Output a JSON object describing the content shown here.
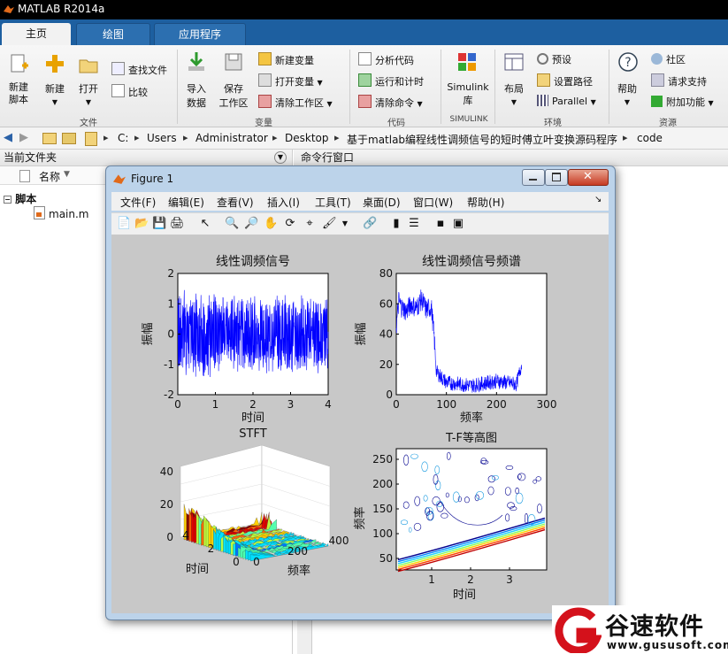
{
  "app": {
    "title": "MATLAB R2014a"
  },
  "tabs": [
    "主页",
    "绘图",
    "应用程序"
  ],
  "ribbon": {
    "big_buttons": [
      {
        "label": "新建\n脚本",
        "icon": "new-script-icon"
      },
      {
        "label": "新建",
        "icon": "new-icon"
      },
      {
        "label": "打开",
        "icon": "open-folder-icon"
      },
      {
        "label": "导入\n数据",
        "icon": "import-data-icon"
      },
      {
        "label": "保存\n工作区",
        "icon": "save-workspace-icon"
      },
      {
        "label": "Simulink\n库",
        "icon": "simulink-library-icon"
      },
      {
        "label": "布局",
        "icon": "layout-icon"
      },
      {
        "label": "帮助",
        "icon": "help-icon"
      }
    ],
    "small_buttons": {
      "find_files": "查找文件",
      "compare": "比较",
      "new_variable": "新建变量",
      "open_variable": "打开变量",
      "clear_workspace": "清除工作区",
      "analyze_code": "分析代码",
      "run_and_time": "运行和计时",
      "clear_commands": "清除命令",
      "preferences": "预设",
      "set_path": "设置路径",
      "parallel": "Parallel",
      "community": "社区",
      "request_support": "请求支持",
      "add_ons": "附加功能"
    },
    "groups": [
      "文件",
      "变量",
      "代码",
      "SIMULINK",
      "环境",
      "资源"
    ]
  },
  "address": {
    "path": [
      "C:",
      "Users",
      "Administrator",
      "Desktop",
      "基于matlab编程线性调频信号的短时傅立叶变换源码程序",
      "code"
    ]
  },
  "left_panel": {
    "title": "当前文件夹",
    "column_name": "名称",
    "sort_indicator": "▼",
    "tree": {
      "folder": "脚本",
      "file": "main.m"
    }
  },
  "command_window": {
    "title": "命令行窗口"
  },
  "figure": {
    "title": "Figure 1",
    "menu": [
      "文件(F)",
      "编辑(E)",
      "查看(V)",
      "插入(I)",
      "工具(T)",
      "桌面(D)",
      "窗口(W)",
      "帮助(H)"
    ]
  },
  "chart_data": [
    {
      "type": "line",
      "title": "线性调频信号",
      "xlabel": "时间",
      "ylabel": "振幅",
      "xlim": [
        0,
        4
      ],
      "ylim": [
        -2,
        2
      ],
      "xticks": [
        "0",
        "1",
        "2",
        "3",
        "4"
      ],
      "yticks": [
        "-2",
        "-1",
        "0",
        "1",
        "2"
      ],
      "series": [
        {
          "color": "#0000ff",
          "description_values": {
            "x_range": [
              0,
              4
            ],
            "amplitude_range": [
              -1.5,
              1.6
            ]
          }
        }
      ]
    },
    {
      "type": "line",
      "title": "线性调频信号频谱",
      "xlabel": "频率",
      "ylabel": "振幅",
      "xlim": [
        0,
        300
      ],
      "ylim": [
        0,
        80
      ],
      "xticks": [
        "0",
        "100",
        "200",
        "300"
      ],
      "yticks": [
        "0",
        "20",
        "40",
        "60",
        "80"
      ],
      "series": [
        {
          "color": "#0000ff",
          "x": [
            0,
            5,
            10,
            20,
            30,
            40,
            50,
            60,
            70,
            75,
            80,
            100,
            150,
            200,
            240,
            250
          ],
          "y": [
            45,
            62,
            58,
            55,
            60,
            57,
            63,
            56,
            58,
            40,
            15,
            8,
            6,
            9,
            7,
            20
          ]
        }
      ]
    },
    {
      "type": "surface",
      "title": "STFT",
      "xlabel": "频率",
      "ylabel": "时间",
      "zlim": [
        0,
        40
      ],
      "zticks": [
        "0",
        "20",
        "40"
      ],
      "xticks": [
        "0",
        "200",
        "400"
      ],
      "yticks": [
        "0",
        "2",
        "4"
      ]
    },
    {
      "type": "contour",
      "title": "T-F等高图",
      "xlabel": "时间",
      "ylabel": "频率",
      "xticks": [
        "1",
        "2",
        "3"
      ],
      "yticks": [
        "50",
        "100",
        "150",
        "200",
        "250"
      ]
    }
  ],
  "watermark": {
    "brand": "谷速软件",
    "url": "www.gususoft.com"
  },
  "colors": {
    "tab_blue": "#1d5fa0",
    "plot_blue": "#0000ff",
    "figure_bg": "#c8c8c8"
  }
}
